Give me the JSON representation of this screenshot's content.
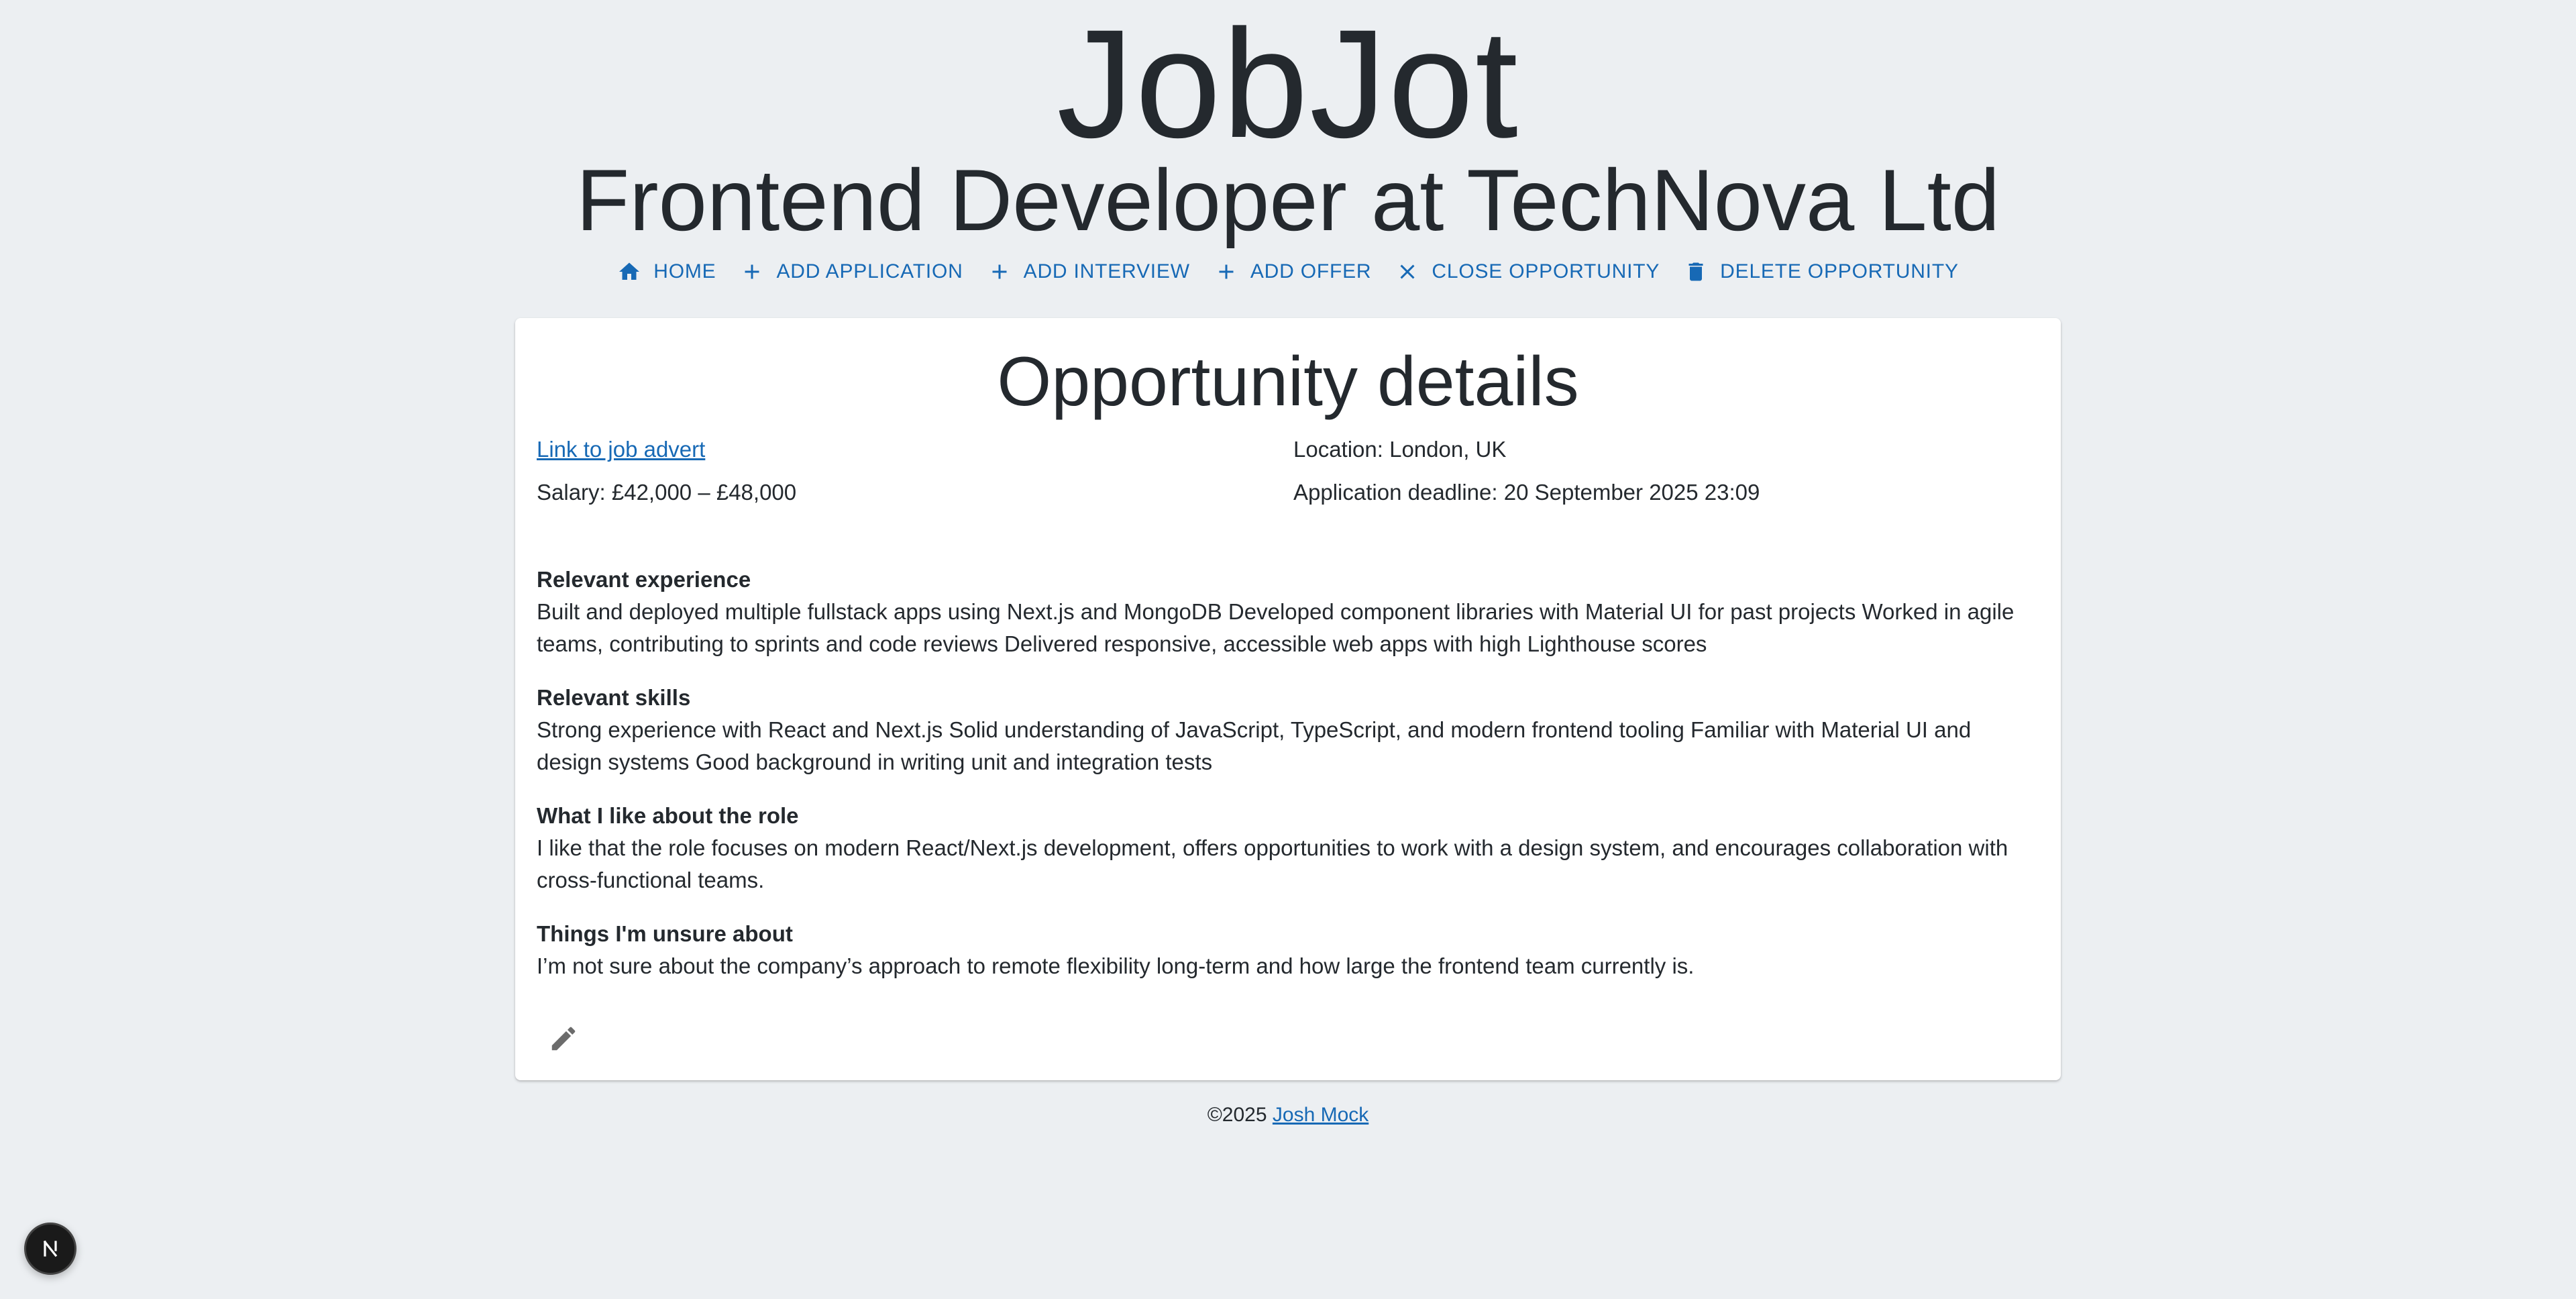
{
  "app": {
    "title": "JobJot"
  },
  "opportunity": {
    "title": "Frontend Developer at TechNova Ltd"
  },
  "toolbar": {
    "items": [
      {
        "label": "HOME",
        "icon": "home-icon"
      },
      {
        "label": "ADD APPLICATION",
        "icon": "plus-icon"
      },
      {
        "label": "ADD INTERVIEW",
        "icon": "plus-icon"
      },
      {
        "label": "ADD OFFER",
        "icon": "plus-icon"
      },
      {
        "label": "CLOSE OPPORTUNITY",
        "icon": "close-icon"
      },
      {
        "label": "DELETE OPPORTUNITY",
        "icon": "trash-icon"
      }
    ]
  },
  "details": {
    "heading": "Opportunity details",
    "advert_link": "Link to job advert",
    "location": "Location: London, UK",
    "salary": "Salary: £42,000 – £48,000",
    "deadline": "Application deadline: 20 September 2025 23:09",
    "sections": [
      {
        "heading": "Relevant experience",
        "body": "Built and deployed multiple fullstack apps using Next.js and MongoDB Developed component libraries with Material UI for past projects Worked in agile teams, contributing to sprints and code reviews Delivered responsive, accessible web apps with high Lighthouse scores"
      },
      {
        "heading": "Relevant skills",
        "body": "Strong experience with React and Next.js Solid understanding of JavaScript, TypeScript, and modern frontend tooling Familiar with Material UI and design systems Good background in writing unit and integration tests"
      },
      {
        "heading": "What I like about the role",
        "body": "I like that the role focuses on modern React/Next.js development, offers opportunities to work with a design system, and encourages collaboration with cross-functional teams."
      },
      {
        "heading": "Things I'm unsure about",
        "body": "I’m not sure about the company’s approach to remote flexibility long-term and how large the frontend team currently is."
      }
    ],
    "edit_icon": "pencil-icon"
  },
  "footer": {
    "copyright": "©2025",
    "author": "Josh Mock"
  },
  "dev_badge": {
    "label": "N"
  },
  "colors": {
    "background": "#eceff2",
    "accent": "#1769b5",
    "card": "#ffffff",
    "text": "#24292e"
  }
}
